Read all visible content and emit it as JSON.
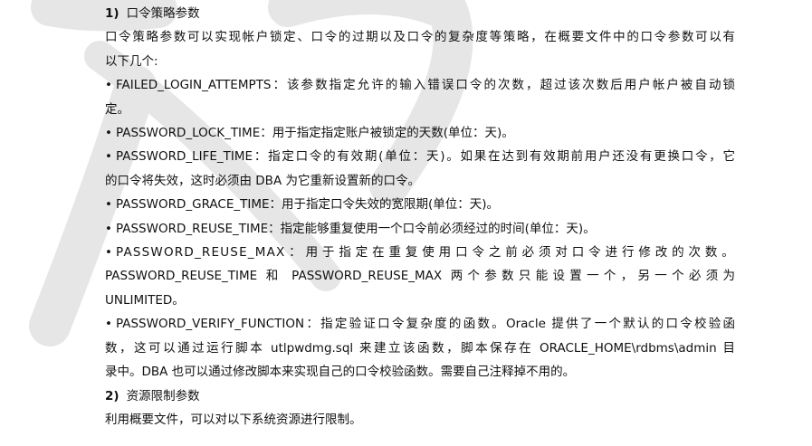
{
  "section1": {
    "number": "1)",
    "title": "口令策略参数"
  },
  "intro": {
    "line1": "口令策略参数可以实现帐户锁定、口令的过期以及口令的复杂度等策略，在概要文件中的口令参数可以有",
    "line2": "以下几个:"
  },
  "bullet_symbol": "•",
  "params": [
    {
      "lines": [
        "FAILED_LOGIN_ATTEMPTS：该参数指定允许的输入错误口令的次数，超过该次数后用户帐户被自动锁",
        "定。"
      ]
    },
    {
      "lines": [
        "PASSWORD_LOCK_TIME：用于指定指定账户被锁定的天数(单位：天)。"
      ]
    },
    {
      "lines": [
        "PASSWORD_LIFE_TIME：指定口令的有效期(单位：天)。如果在达到有效期前用户还没有更换口令，它",
        "的口令将失效，这时必须由 DBA 为它重新设置新的口令。"
      ]
    },
    {
      "lines": [
        "PASSWORD_GRACE_TIME：用于指定口令失效的宽限期(单位：天)。"
      ]
    },
    {
      "lines": [
        "PASSWORD_REUSE_TIME：指定能够重复使用一个口令前必须经过的时间(单位：天)。"
      ]
    },
    {
      "lines": [
        "PASSWORD_REUSE_MAX：用于指定在重复使用口令之前必须对口令进行修改的次数。",
        "PASSWORD_REUSE_TIME 和 PASSWORD_REUSE_MAX 两个参数只能设置一个，另一个必须为",
        "UNLIMITED。"
      ]
    },
    {
      "lines": [
        "PASSWORD_VERIFY_FUNCTION：指定验证口令复杂度的函数。Oracle 提供了一个默认的口令校验函",
        "数，这可以通过运行脚本 utlpwdmg.sql 来建立该函数，脚本保存在 ORACLE_HOME\\rdbms\\admin 目",
        "录中。DBA 也可以通过修改脚本来实现自己的口令校验函数。需要自己注释掉不用的。"
      ]
    }
  ],
  "section2": {
    "number": "2)",
    "title": "资源限制参数"
  },
  "outro": "利用概要文件，可以对以下系统资源进行限制。",
  "colors": {
    "text": "#111111",
    "watermark": "#e6e6e6",
    "background": "#ffffff"
  }
}
